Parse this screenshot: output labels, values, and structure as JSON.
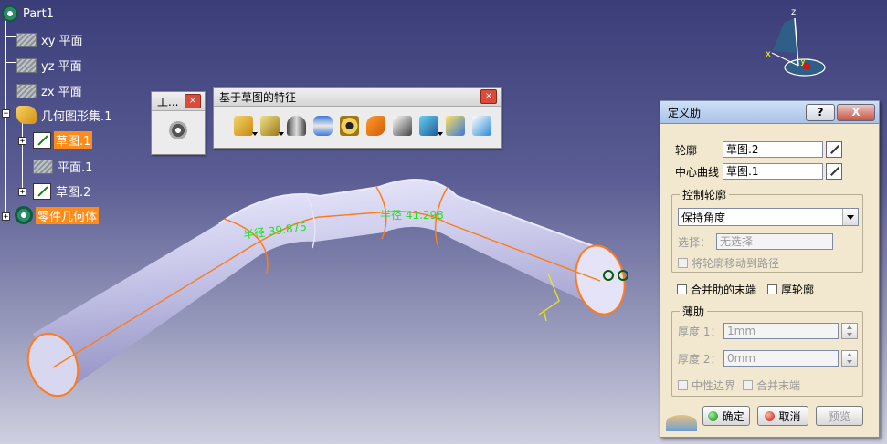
{
  "tree": {
    "root": "Part1",
    "xy_plane": "xy 平面",
    "yz_plane": "yz 平面",
    "zx_plane": "zx 平面",
    "geo_set": "几何图形集.1",
    "sketch1": "草图.1",
    "plane1": "平面.1",
    "sketch2": "草图.2",
    "body": "零件几何体"
  },
  "toolbar_small": {
    "title": "工...",
    "close": "×"
  },
  "toolbar_features": {
    "title": "基于草图的特征",
    "close": "×"
  },
  "annotations": {
    "radius1": "半径 39.875",
    "radius2": "半径 41.298"
  },
  "compass": {
    "x": "x",
    "y": "y",
    "z": "z"
  },
  "dialog": {
    "title": "定义肋",
    "help": "?",
    "close": "X",
    "profile_label": "轮廓",
    "profile_value": "草图.2",
    "center_curve_label": "中心曲线",
    "center_curve_value": "草图.1",
    "control_profile": {
      "title": "控制轮廓",
      "mode": "保持角度",
      "select_label": "选择：",
      "select_value": "无选择",
      "move_profile": "将轮廓移动到路径"
    },
    "merge_ends": "合并肋的末端",
    "thick_profile": "厚轮廓",
    "thin_rib": {
      "title": "薄肋",
      "thickness1_label": "厚度 1：",
      "thickness1_value": "1mm",
      "thickness2_label": "厚度 2：",
      "thickness2_value": "0mm",
      "neutral_fiber": "中性边界",
      "merge_ends": "合并末端"
    },
    "ok": "确定",
    "cancel": "取消",
    "preview": "预览"
  }
}
